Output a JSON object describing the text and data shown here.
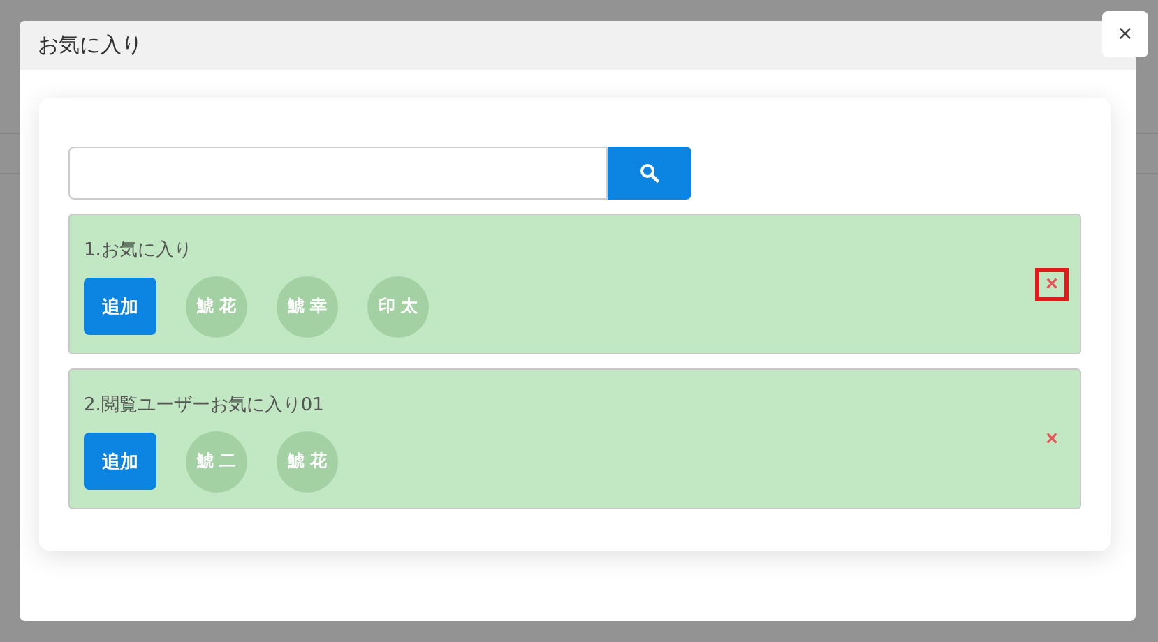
{
  "dialog": {
    "title": "お気に入り",
    "close_label": "×"
  },
  "groups": [
    {
      "title": "1.お気に入り",
      "add_label": "追加",
      "members": [
        "鯱 花",
        "鯱 幸",
        "印 太"
      ],
      "delete_label": "×",
      "highlighted": true
    },
    {
      "title": "2.閲覧ユーザーお気に入り01",
      "add_label": "追加",
      "members": [
        "鯱 二",
        "鯱 花"
      ],
      "delete_label": "×",
      "highlighted": false
    }
  ]
}
